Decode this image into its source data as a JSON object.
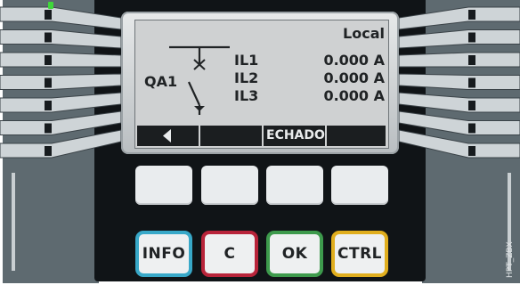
{
  "lcd": {
    "status_label": "Local",
    "device_label": "QA1",
    "phases": [
      {
        "label": "IL1",
        "value": "0.000 A"
      },
      {
        "label": "IL2",
        "value": "0.000 A"
      },
      {
        "label": "IL3",
        "value": "0.000 A"
      }
    ],
    "softkeys": [
      {
        "icon": "arrow-left-icon",
        "label": ""
      },
      {
        "label": ""
      },
      {
        "label": "ECHADO"
      },
      {
        "label": ""
      }
    ]
  },
  "keys": {
    "info": {
      "label": "INFO",
      "color": "#38a8c8"
    },
    "clear": {
      "label": "C",
      "color": "#b8243a"
    },
    "ok": {
      "label": "OK",
      "color": "#3d9a4c"
    },
    "ctrl": {
      "label": "CTRL",
      "color": "#e0ae1e"
    }
  },
  "status_led": {
    "color": "#3fd83a"
  },
  "model_code": "HPT_ZBX",
  "colors": {
    "housing": "#5e6a70",
    "front_panel": "#101417",
    "lcd_background": "#cfd1d2",
    "softkey_bar": "#1b1e20"
  }
}
